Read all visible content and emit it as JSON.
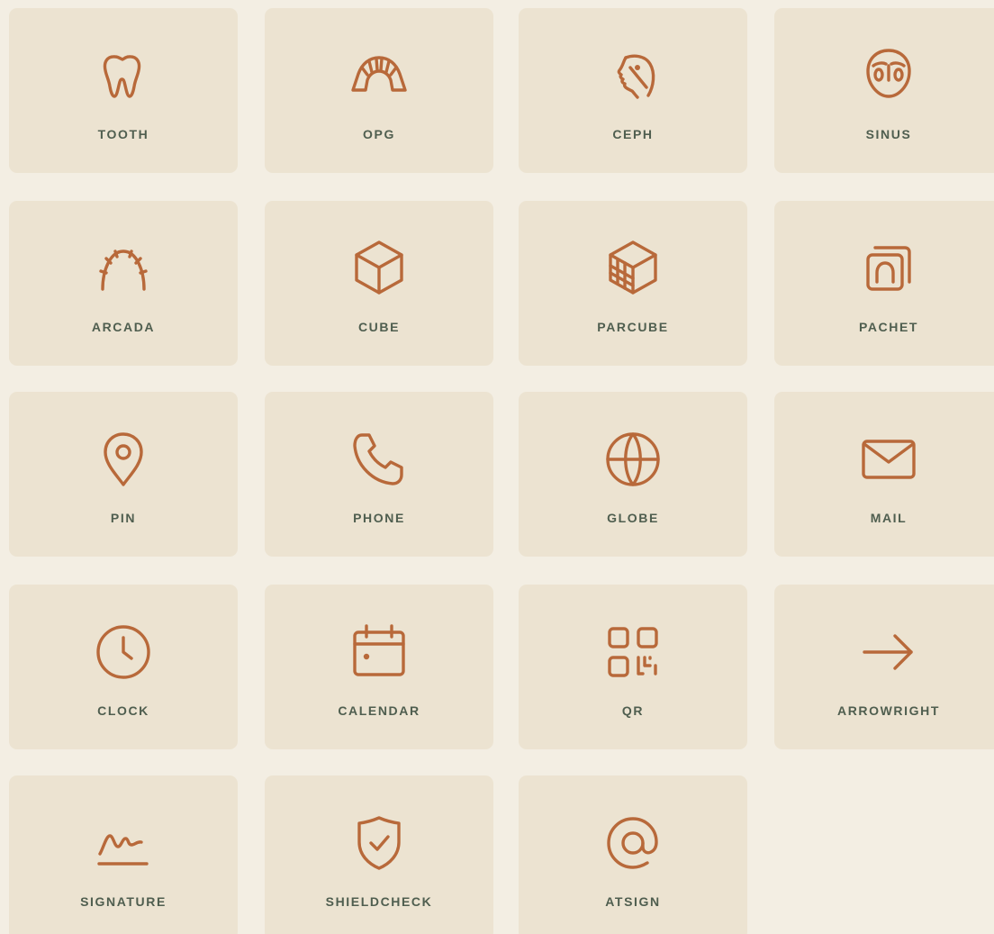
{
  "theme": {
    "background": "#f3eee3",
    "card": "#ece3d1",
    "icon": "#b8693a",
    "label": "#4f5e4f"
  },
  "icons": [
    {
      "label": "TOOTH",
      "icon": "tooth-icon"
    },
    {
      "label": "OPG",
      "icon": "opg-icon"
    },
    {
      "label": "CEPH",
      "icon": "ceph-icon"
    },
    {
      "label": "SINUS",
      "icon": "sinus-icon"
    },
    {
      "label": "ARCADA",
      "icon": "arcada-icon"
    },
    {
      "label": "CUBE",
      "icon": "cube-icon"
    },
    {
      "label": "PARCUBE",
      "icon": "parcube-icon"
    },
    {
      "label": "PACHET",
      "icon": "pachet-icon"
    },
    {
      "label": "PIN",
      "icon": "pin-icon"
    },
    {
      "label": "PHONE",
      "icon": "phone-icon"
    },
    {
      "label": "GLOBE",
      "icon": "globe-icon"
    },
    {
      "label": "MAIL",
      "icon": "mail-icon"
    },
    {
      "label": "CLOCK",
      "icon": "clock-icon"
    },
    {
      "label": "CALENDAR",
      "icon": "calendar-icon"
    },
    {
      "label": "QR",
      "icon": "qr-icon"
    },
    {
      "label": "ARROWRIGHT",
      "icon": "arrow-right-icon"
    },
    {
      "label": "SIGNATURE",
      "icon": "signature-icon"
    },
    {
      "label": "SHIELDCHECK",
      "icon": "shield-check-icon"
    },
    {
      "label": "ATSIGN",
      "icon": "at-sign-icon"
    }
  ]
}
